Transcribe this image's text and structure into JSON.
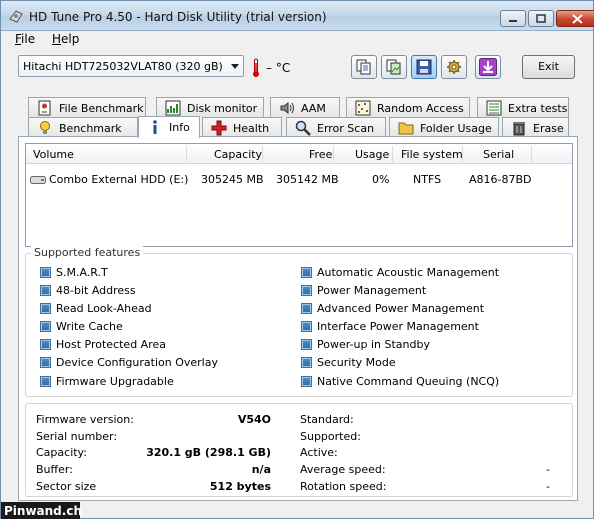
{
  "window": {
    "title": "HD Tune Pro 4.50 - Hard Disk Utility (trial version)"
  },
  "menu": [
    {
      "label": "File",
      "mnemonic": "F",
      "rest": "ile"
    },
    {
      "label": "Help",
      "mnemonic": "H",
      "rest": "elp"
    }
  ],
  "toolbar": {
    "drive": "Hitachi HDT725032VLAT80  (320 gB)",
    "temperature": "– °C",
    "exit_label": "Exit",
    "buttons": [
      "copy-text",
      "copy-screenshot",
      "save",
      "settings",
      "download"
    ]
  },
  "tabs": {
    "row1": [
      "File Benchmark",
      "Disk monitor",
      "AAM",
      "Random Access",
      "Extra tests"
    ],
    "row2": [
      "Benchmark",
      "Info",
      "Health",
      "Error Scan",
      "Folder Usage",
      "Erase"
    ],
    "selected": "Info"
  },
  "volumes": {
    "headers": [
      "Volume",
      "Capacity",
      "Free",
      "Usage",
      "File system",
      "Serial"
    ],
    "rows": [
      {
        "volume": "Combo External HDD (E:)",
        "capacity": "305245 MB",
        "free": "305142 MB",
        "usage": "0%",
        "fs": "NTFS",
        "serial": "A816-87BD"
      }
    ]
  },
  "features": {
    "title": "Supported features",
    "left": [
      "S.M.A.R.T",
      "48-bit Address",
      "Read Look-Ahead",
      "Write Cache",
      "Host Protected Area",
      "Device Configuration Overlay",
      "Firmware Upgradable"
    ],
    "right": [
      "Automatic Acoustic Management",
      "Power Management",
      "Advanced Power Management",
      "Interface Power Management",
      "Power-up in Standby",
      "Security Mode",
      "Native Command Queuing (NCQ)"
    ]
  },
  "info": {
    "firmware_label": "Firmware version:",
    "firmware": "V54O",
    "serial_label": "Serial number:",
    "serial": "",
    "capacity_label": "Capacity:",
    "capacity": "320.1 gB (298.1 GB)",
    "buffer_label": "Buffer:",
    "buffer": "n/a",
    "sector_label": "Sector size",
    "sector": "512 bytes",
    "standard_label": "Standard:",
    "standard": "",
    "supported_label": "Supported:",
    "supported": "",
    "active_label": "Active:",
    "active": "",
    "avg_speed_label": "Average speed:",
    "avg_speed": "-",
    "rotation_label": "Rotation speed:",
    "rotation": "-"
  },
  "watermark": "Pinwand.ch",
  "colors": {
    "check_blue": "#2f6aa3",
    "close_red": "#c9442a",
    "selected_tab": "#ffffff"
  }
}
